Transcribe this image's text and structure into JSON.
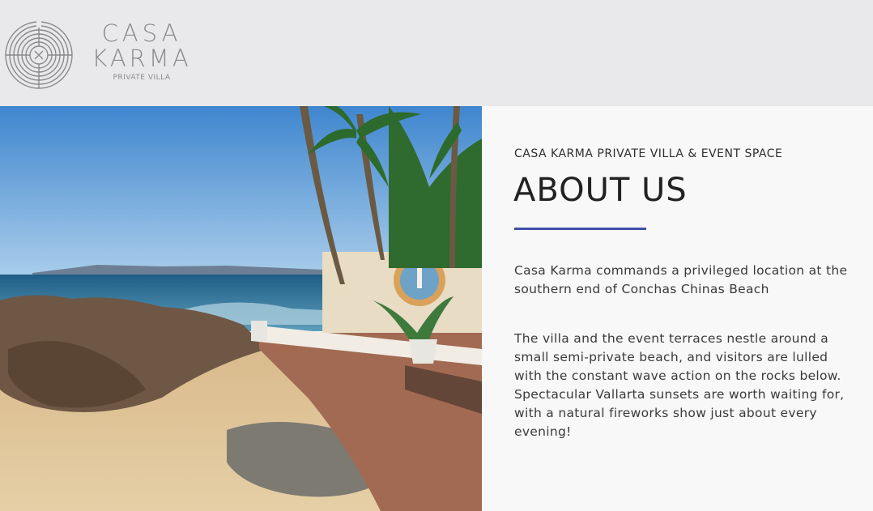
{
  "brand": {
    "name_line1": "CASA",
    "name_line2": "KARMA",
    "tagline": "PRIVATE VILLA",
    "logo_icon": "labyrinth-logo-icon"
  },
  "hero_image": {
    "subject": "beach-rocks-villa-terrace-photo"
  },
  "about": {
    "eyebrow": "CASA KARMA PRIVATE VILLA & EVENT SPACE",
    "title": "ABOUT US",
    "accent_color": "#3f51a6",
    "paragraph1": "Casa Karma commands a privileged location at the southern end of Conchas Chinas Beach",
    "paragraph2": "The villa and the event terraces nestle around a small semi-private beach, and visitors are lulled with the constant wave action on the rocks below. Spectacular Vallarta sunsets are worth waiting for, with a natural fireworks show just about every evening!"
  },
  "colors": {
    "header_bg": "#e9e9eb",
    "content_bg": "#f8f8f8",
    "logo_gray": "#8a8a8a"
  }
}
